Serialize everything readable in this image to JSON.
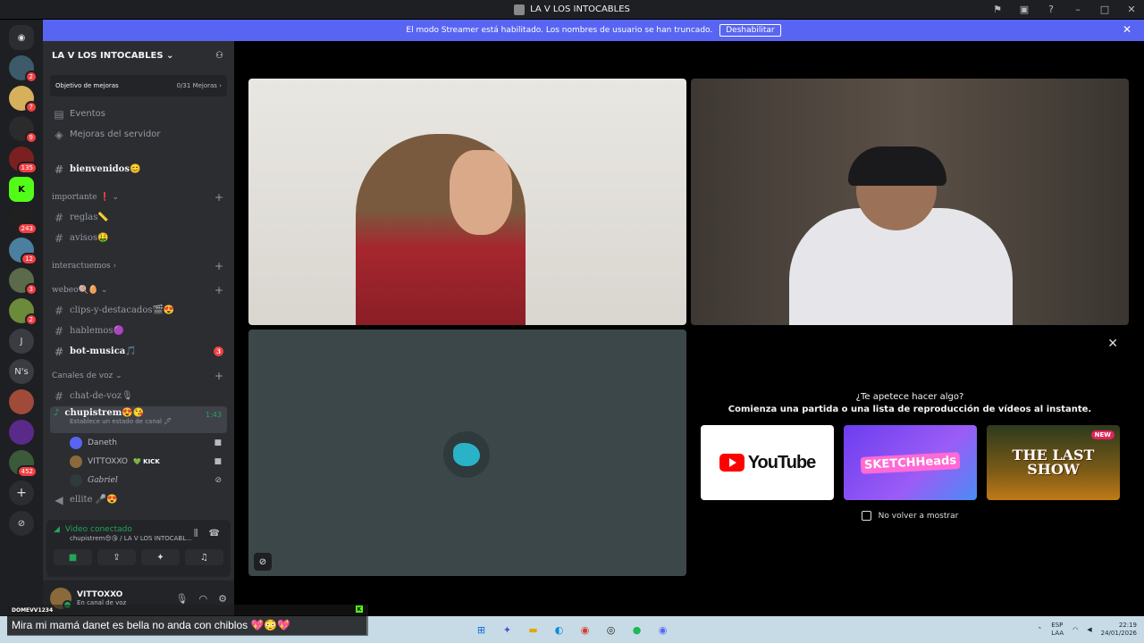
{
  "window": {
    "title": "LA V LOS INTOCABLES"
  },
  "banner": {
    "text": "El modo Streamer está habilitado. Los nombres de usuario se han truncado.",
    "button_label": "Deshabilitar",
    "close_icon": "close-icon"
  },
  "guilds": [
    {
      "label": "",
      "badge": ""
    },
    {
      "label": "",
      "badge": "2"
    },
    {
      "label": "",
      "badge": "7"
    },
    {
      "label": "",
      "badge": "9"
    },
    {
      "label": "",
      "badge": "135"
    },
    {
      "label": "K",
      "badge": ""
    },
    {
      "label": "",
      "badge": "243"
    },
    {
      "label": "",
      "badge": "12"
    },
    {
      "label": "",
      "badge": "3"
    },
    {
      "label": "",
      "badge": "2"
    },
    {
      "label": "J",
      "badge": ""
    },
    {
      "label": "N's",
      "badge": ""
    },
    {
      "label": "",
      "badge": ""
    },
    {
      "label": "",
      "badge": ""
    },
    {
      "label": "",
      "badge": "452"
    },
    {
      "label": "+",
      "badge": ""
    },
    {
      "label": "⊘",
      "badge": ""
    }
  ],
  "sidebar": {
    "server_name": "LA V LOS INTOCABLES",
    "boost": {
      "label": "Objetivo de mejoras",
      "progress": "0/31 Mejoras"
    },
    "links": [
      {
        "label": "Eventos"
      },
      {
        "label": "Mejoras del servidor"
      }
    ],
    "channels": {
      "bienvenidos": "bienvenidos😊",
      "cat_importante": "importante ❗",
      "reglas": "reglas📏",
      "avisos": "avisos🤑",
      "cat_interactuemos": "interactuemos",
      "cat_webeo": "webeo🍭🥚",
      "clips": "clips-y-destacados🎬😍",
      "hablemos": "hablemos🟣",
      "bot_musica": "bot-musica🎵",
      "bot_musica_mentions": "3",
      "cat_voz": "Canales de voz",
      "chat_de_voz": "chat-de-voz🎙",
      "chupistrem": "chupistrem😍😘",
      "chupistrem_status": "Establece un estado de canal 🖊",
      "chupistrem_time": "1:43",
      "ellite": "ellite 🎤😍"
    },
    "voice_users": [
      {
        "name": "Daneth",
        "extra": ""
      },
      {
        "name": "VITTOXXO",
        "extra": "💚 KICK"
      },
      {
        "name": "Gabriel",
        "extra": ""
      }
    ],
    "vc_panel": {
      "status": "Video conectado",
      "channel": "chupistrem😍😘 / LA V LOS INTOCABL..."
    },
    "user": {
      "name": "VITTOXXO",
      "status": "En canal de voz"
    }
  },
  "activity": {
    "question": "¿Te apetece hacer algo?",
    "subtitle": "Comienza una partida o una lista de reproducción de vídeos al instante.",
    "cards": [
      {
        "title": "YouTube"
      },
      {
        "title": "SKETCHHeads"
      },
      {
        "title": "THE LAST SHOW",
        "badge": "NEW"
      }
    ],
    "dont_show": "No volver a mostrar"
  },
  "chat_overlay": {
    "user": "DOMEVV1234",
    "message": "Mira mi mamá danet es bella no anda con chiblos 💖😳💖"
  },
  "tray": {
    "lang1": "ESP",
    "lang2": "LAA",
    "time": "22:19",
    "date": "24/01/2026"
  },
  "colors": {
    "accent": "#5865f2",
    "online": "#23a559",
    "danger": "#f23f43",
    "sidebar": "#2b2d31",
    "guild_bar": "#1e1f22"
  }
}
